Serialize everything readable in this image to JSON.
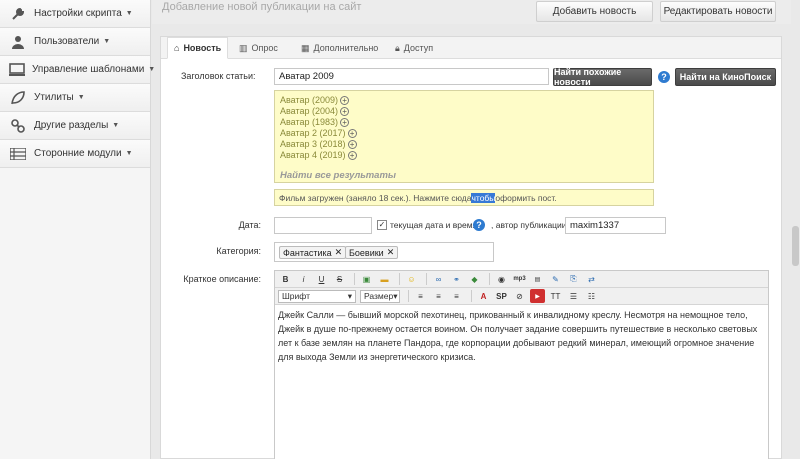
{
  "sidebar": {
    "items": [
      {
        "label": "Настройки скрипта",
        "icon": "wrench-icon"
      },
      {
        "label": "Пользователи",
        "icon": "user-icon"
      },
      {
        "label": "Управление шаблонами",
        "icon": "monitor-icon"
      },
      {
        "label": "Утилиты",
        "icon": "leaf-icon"
      },
      {
        "label": "Другие разделы",
        "icon": "link-icon"
      },
      {
        "label": "Сторонние модули",
        "icon": "list-icon"
      }
    ]
  },
  "header": {
    "title": "Добавление новой публикации на сайт",
    "add_news": "Добавить новость",
    "edit_news": "Редактировать новости"
  },
  "tabs": [
    {
      "label": "Новость",
      "icon": "home-icon"
    },
    {
      "label": "Опрос",
      "icon": "chart-icon"
    },
    {
      "label": "Дополнительно",
      "icon": "grid-icon"
    },
    {
      "label": "Доступ",
      "icon": "lock-icon"
    }
  ],
  "form": {
    "title_label": "Заголовок статьи:",
    "title_value": "Аватар 2009",
    "find_similar": "Найти похожие новости",
    "find_kinopoisk": "Найти на КиноПоиск",
    "suggestions": [
      "Аватар (2009)",
      "Аватар (2004)",
      "Аватар (1983)",
      "Аватар 2 (2017)",
      "Аватар 3 (2018)",
      "Аватар 4 (2019)"
    ],
    "find_all": "Найти все результаты",
    "notice_before": "Фильм загружен (заняло 18 сек.). Нажмите сюда ",
    "notice_highlight": "чтобы",
    "notice_after": " оформить пост.",
    "date_label": "Дата:",
    "date_value": "",
    "current_date_label": "текущая дата и время",
    "author_label": ", автор публикации:",
    "author_value": "maxim1337",
    "category_label": "Категория:",
    "categories": [
      "Фантастика",
      "Боевики"
    ],
    "short_desc_label": "Краткое описание:",
    "font_select": "Шрифт",
    "size_select": "Размер",
    "short_desc_text": "Джейк Салли — бывший морской пехотинец, прикованный к инвалидному креслу. Несмотря на немощное тело, Джейк в душе по-прежнему остается воином. Он получает задание совершить путешествие в несколько световых лет к базе землян на планете Пандора, где корпорации добывают редкий минерал, имеющий огромное значение для выхода Земли из энергетического кризиса."
  }
}
